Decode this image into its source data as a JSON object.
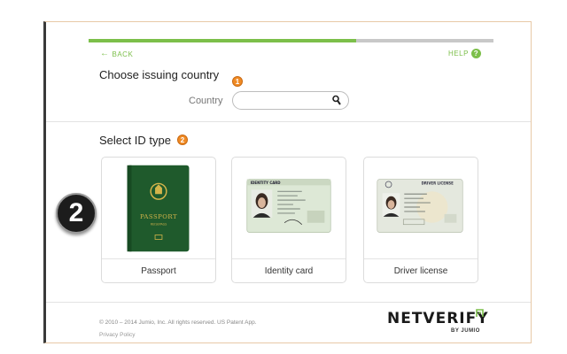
{
  "navigation": {
    "back_label": "BACK",
    "help_label": "HELP",
    "help_icon_glyph": "?"
  },
  "progress": {
    "fraction": 0.66,
    "color": "#7cbf4a"
  },
  "country_section": {
    "heading": "Choose issuing country",
    "step_badge": "1",
    "field_label": "Country",
    "field_value": ""
  },
  "id_section": {
    "heading": "Select ID type",
    "step_badge": "2",
    "options": [
      {
        "label": "Passport",
        "icon": "passport-image",
        "passport_text": "PASSPORT",
        "passport_subtext": "REISEPASS"
      },
      {
        "label": "Identity card",
        "icon": "identity-card-image",
        "card_header": "IDENTITY CARD"
      },
      {
        "label": "Driver license",
        "icon": "driver-license-image",
        "card_header": "DRIVER LICENSE"
      }
    ]
  },
  "annotation": {
    "big_step_number": "2"
  },
  "footer": {
    "copyright": "© 2010 – 2014 Jumio, Inc. All rights reserved. US Patent App.",
    "privacy_label": "Privacy Policy"
  },
  "logo": {
    "wordmark": "NETVERIFY",
    "tagline": "BY JUMIO"
  },
  "colors": {
    "accent": "#7cbf4a",
    "badge": "#f08a24",
    "passport_green": "#1f5a2c"
  }
}
